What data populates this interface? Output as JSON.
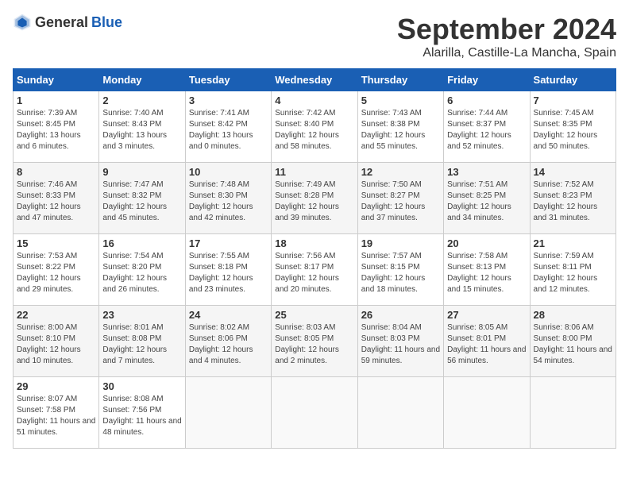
{
  "logo": {
    "general": "General",
    "blue": "Blue"
  },
  "title": "September 2024",
  "location": "Alarilla, Castille-La Mancha, Spain",
  "headers": [
    "Sunday",
    "Monday",
    "Tuesday",
    "Wednesday",
    "Thursday",
    "Friday",
    "Saturday"
  ],
  "weeks": [
    [
      {
        "day": "1",
        "sunrise": "Sunrise: 7:39 AM",
        "sunset": "Sunset: 8:45 PM",
        "daylight": "Daylight: 13 hours and 6 minutes."
      },
      {
        "day": "2",
        "sunrise": "Sunrise: 7:40 AM",
        "sunset": "Sunset: 8:43 PM",
        "daylight": "Daylight: 13 hours and 3 minutes."
      },
      {
        "day": "3",
        "sunrise": "Sunrise: 7:41 AM",
        "sunset": "Sunset: 8:42 PM",
        "daylight": "Daylight: 13 hours and 0 minutes."
      },
      {
        "day": "4",
        "sunrise": "Sunrise: 7:42 AM",
        "sunset": "Sunset: 8:40 PM",
        "daylight": "Daylight: 12 hours and 58 minutes."
      },
      {
        "day": "5",
        "sunrise": "Sunrise: 7:43 AM",
        "sunset": "Sunset: 8:38 PM",
        "daylight": "Daylight: 12 hours and 55 minutes."
      },
      {
        "day": "6",
        "sunrise": "Sunrise: 7:44 AM",
        "sunset": "Sunset: 8:37 PM",
        "daylight": "Daylight: 12 hours and 52 minutes."
      },
      {
        "day": "7",
        "sunrise": "Sunrise: 7:45 AM",
        "sunset": "Sunset: 8:35 PM",
        "daylight": "Daylight: 12 hours and 50 minutes."
      }
    ],
    [
      {
        "day": "8",
        "sunrise": "Sunrise: 7:46 AM",
        "sunset": "Sunset: 8:33 PM",
        "daylight": "Daylight: 12 hours and 47 minutes."
      },
      {
        "day": "9",
        "sunrise": "Sunrise: 7:47 AM",
        "sunset": "Sunset: 8:32 PM",
        "daylight": "Daylight: 12 hours and 45 minutes."
      },
      {
        "day": "10",
        "sunrise": "Sunrise: 7:48 AM",
        "sunset": "Sunset: 8:30 PM",
        "daylight": "Daylight: 12 hours and 42 minutes."
      },
      {
        "day": "11",
        "sunrise": "Sunrise: 7:49 AM",
        "sunset": "Sunset: 8:28 PM",
        "daylight": "Daylight: 12 hours and 39 minutes."
      },
      {
        "day": "12",
        "sunrise": "Sunrise: 7:50 AM",
        "sunset": "Sunset: 8:27 PM",
        "daylight": "Daylight: 12 hours and 37 minutes."
      },
      {
        "day": "13",
        "sunrise": "Sunrise: 7:51 AM",
        "sunset": "Sunset: 8:25 PM",
        "daylight": "Daylight: 12 hours and 34 minutes."
      },
      {
        "day": "14",
        "sunrise": "Sunrise: 7:52 AM",
        "sunset": "Sunset: 8:23 PM",
        "daylight": "Daylight: 12 hours and 31 minutes."
      }
    ],
    [
      {
        "day": "15",
        "sunrise": "Sunrise: 7:53 AM",
        "sunset": "Sunset: 8:22 PM",
        "daylight": "Daylight: 12 hours and 29 minutes."
      },
      {
        "day": "16",
        "sunrise": "Sunrise: 7:54 AM",
        "sunset": "Sunset: 8:20 PM",
        "daylight": "Daylight: 12 hours and 26 minutes."
      },
      {
        "day": "17",
        "sunrise": "Sunrise: 7:55 AM",
        "sunset": "Sunset: 8:18 PM",
        "daylight": "Daylight: 12 hours and 23 minutes."
      },
      {
        "day": "18",
        "sunrise": "Sunrise: 7:56 AM",
        "sunset": "Sunset: 8:17 PM",
        "daylight": "Daylight: 12 hours and 20 minutes."
      },
      {
        "day": "19",
        "sunrise": "Sunrise: 7:57 AM",
        "sunset": "Sunset: 8:15 PM",
        "daylight": "Daylight: 12 hours and 18 minutes."
      },
      {
        "day": "20",
        "sunrise": "Sunrise: 7:58 AM",
        "sunset": "Sunset: 8:13 PM",
        "daylight": "Daylight: 12 hours and 15 minutes."
      },
      {
        "day": "21",
        "sunrise": "Sunrise: 7:59 AM",
        "sunset": "Sunset: 8:11 PM",
        "daylight": "Daylight: 12 hours and 12 minutes."
      }
    ],
    [
      {
        "day": "22",
        "sunrise": "Sunrise: 8:00 AM",
        "sunset": "Sunset: 8:10 PM",
        "daylight": "Daylight: 12 hours and 10 minutes."
      },
      {
        "day": "23",
        "sunrise": "Sunrise: 8:01 AM",
        "sunset": "Sunset: 8:08 PM",
        "daylight": "Daylight: 12 hours and 7 minutes."
      },
      {
        "day": "24",
        "sunrise": "Sunrise: 8:02 AM",
        "sunset": "Sunset: 8:06 PM",
        "daylight": "Daylight: 12 hours and 4 minutes."
      },
      {
        "day": "25",
        "sunrise": "Sunrise: 8:03 AM",
        "sunset": "Sunset: 8:05 PM",
        "daylight": "Daylight: 12 hours and 2 minutes."
      },
      {
        "day": "26",
        "sunrise": "Sunrise: 8:04 AM",
        "sunset": "Sunset: 8:03 PM",
        "daylight": "Daylight: 11 hours and 59 minutes."
      },
      {
        "day": "27",
        "sunrise": "Sunrise: 8:05 AM",
        "sunset": "Sunset: 8:01 PM",
        "daylight": "Daylight: 11 hours and 56 minutes."
      },
      {
        "day": "28",
        "sunrise": "Sunrise: 8:06 AM",
        "sunset": "Sunset: 8:00 PM",
        "daylight": "Daylight: 11 hours and 54 minutes."
      }
    ],
    [
      {
        "day": "29",
        "sunrise": "Sunrise: 8:07 AM",
        "sunset": "Sunset: 7:58 PM",
        "daylight": "Daylight: 11 hours and 51 minutes."
      },
      {
        "day": "30",
        "sunrise": "Sunrise: 8:08 AM",
        "sunset": "Sunset: 7:56 PM",
        "daylight": "Daylight: 11 hours and 48 minutes."
      },
      null,
      null,
      null,
      null,
      null
    ]
  ]
}
